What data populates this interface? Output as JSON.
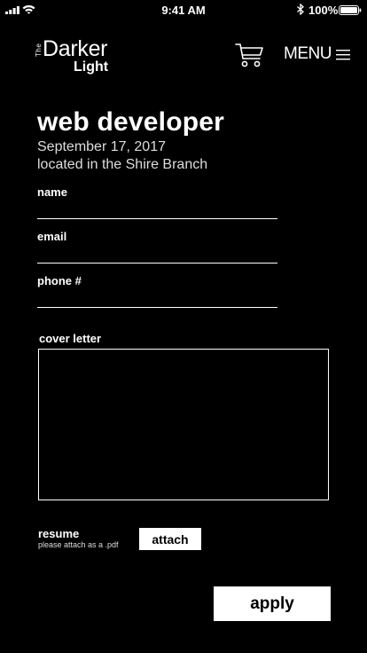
{
  "status_bar": {
    "time": "9:41 AM",
    "battery_percent": "100%",
    "icons": [
      "signal-icon",
      "wifi-icon",
      "bluetooth-icon",
      "battery-icon"
    ]
  },
  "header": {
    "logo": {
      "the": "The",
      "darker": "Darker",
      "light": "Light"
    },
    "cart_icon": "cart-icon",
    "menu_label": "MENU",
    "menu_icon": "hamburger-icon"
  },
  "job": {
    "title": "web developer",
    "date": "September 17, 2017",
    "location": "located in the Shire Branch"
  },
  "form": {
    "name_label": "name",
    "name_value": "",
    "email_label": "email",
    "email_value": "",
    "phone_label": "phone #",
    "phone_value": "",
    "cover_letter_label": "cover letter",
    "cover_letter_value": "",
    "resume_label": "resume",
    "resume_hint": "please attach as a .pdf",
    "attach_label": "attach",
    "apply_label": "apply"
  },
  "colors": {
    "background": "#000000",
    "foreground": "#ffffff"
  }
}
